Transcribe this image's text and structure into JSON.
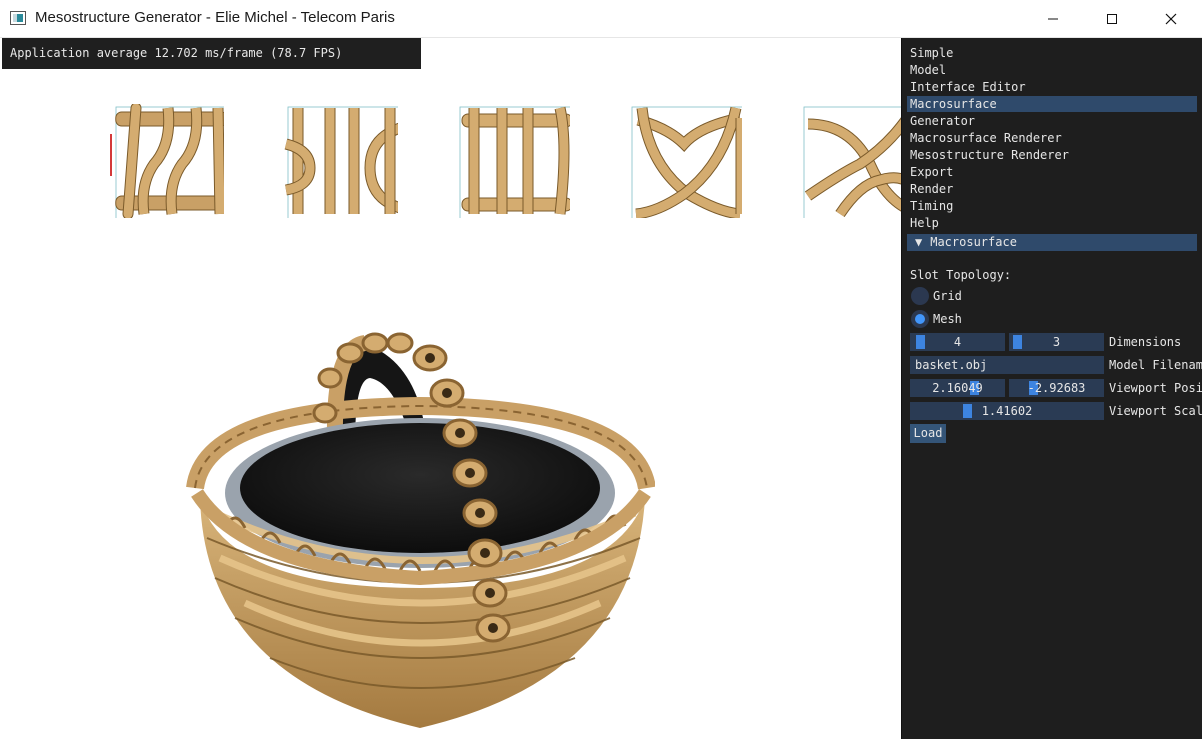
{
  "window": {
    "title": "Mesostructure Generator - Elie Michel - Telecom Paris",
    "minimize_icon": "minimize-icon",
    "maximize_icon": "maximize-icon",
    "close_icon": "close-icon"
  },
  "viewport": {
    "fps_text": "Application average 12.702 ms/frame (78.7 FPS)"
  },
  "panel": {
    "menu": [
      "Simple",
      "Model",
      "Interface Editor",
      "Macrosurface",
      "Generator",
      "Macrosurface Renderer",
      "Mesostructure Renderer",
      "Export",
      "Render",
      "Timing",
      "Help"
    ],
    "active_menu": "Macrosurface",
    "section_header": "Macrosurface",
    "slot_topology_label": "Slot Topology:",
    "radio_grid": "Grid",
    "radio_mesh": "Mesh",
    "selected_topology": "Mesh",
    "dim_x": "4",
    "dim_y": "3",
    "dimensions_label": "Dimensions",
    "model_filename": "basket.obj",
    "model_filename_label": "Model Filenam",
    "viewport_pos_x": "2.16049",
    "viewport_pos_y": "-2.92683",
    "viewport_pos_label": "Viewport Posi",
    "viewport_scale": "1.41602",
    "viewport_scale_label": "Viewport Scal",
    "load_button": "Load"
  },
  "colors": {
    "panel_bg": "#1e1e1e",
    "accent": "#4296fa",
    "highlight": "#2f4a6b",
    "field_bg": "#2a3b54",
    "slot_red": "#d43a3a",
    "slot_orange": "#e08a1e",
    "slot_cyan": "#3ec6e0",
    "wicker": "#c9a066"
  }
}
